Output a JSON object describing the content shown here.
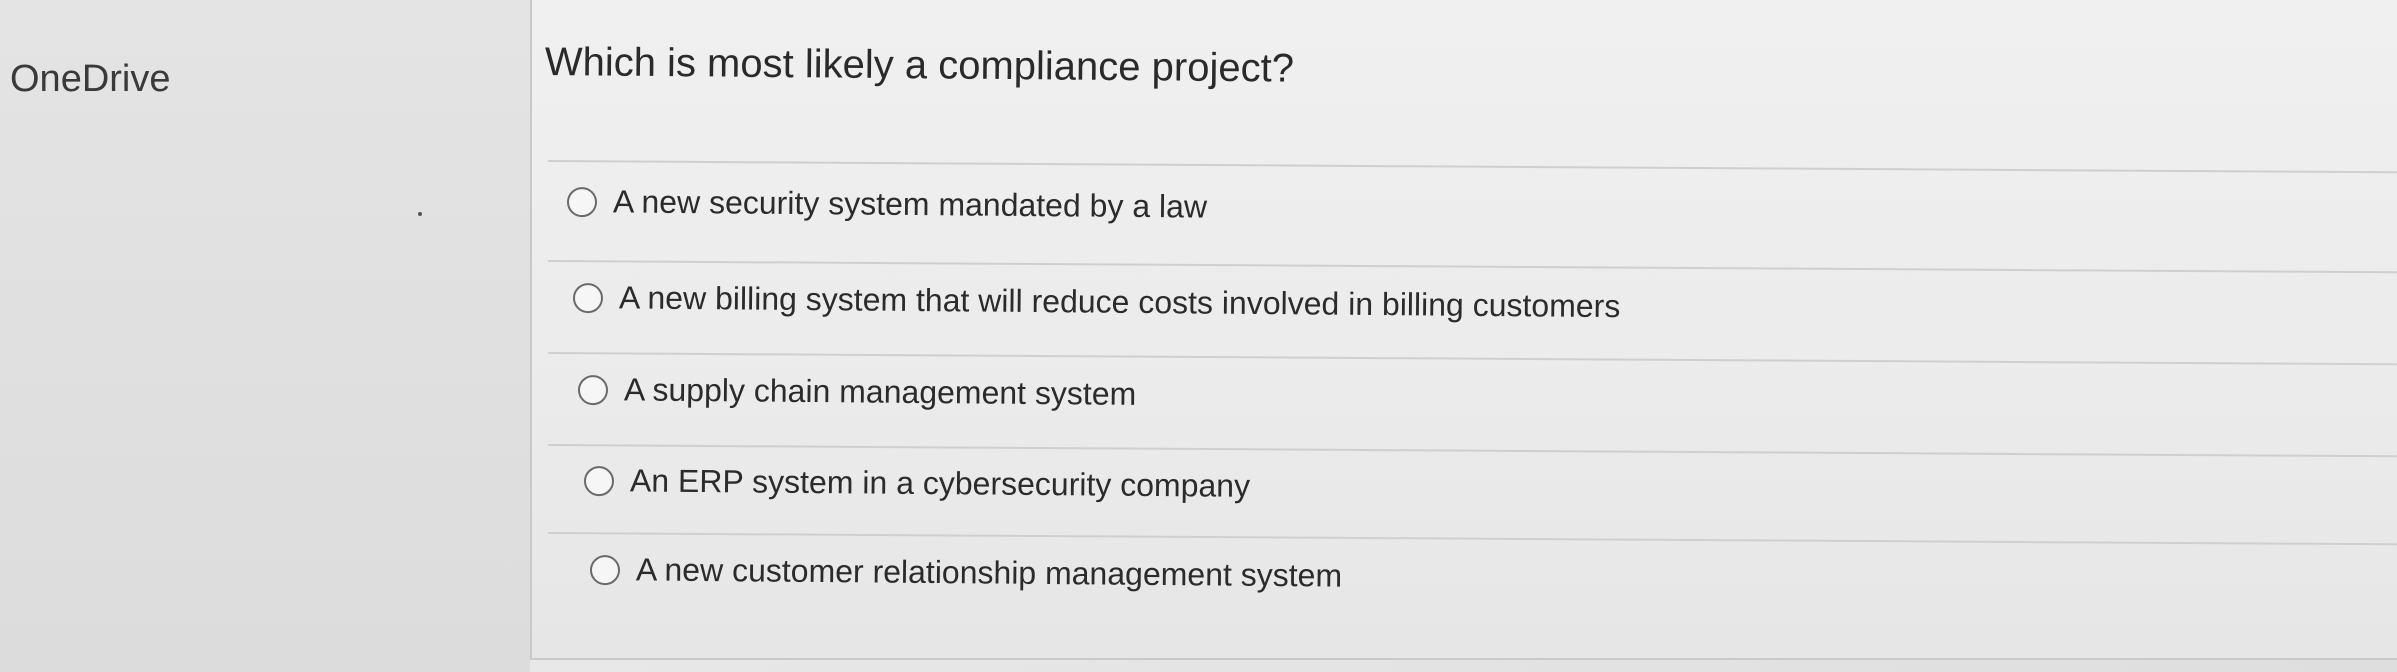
{
  "sidebar": {
    "title": "OneDrive"
  },
  "question": {
    "text": "Which is most likely a compliance project?"
  },
  "options": [
    {
      "label": "A new security system mandated by a law"
    },
    {
      "label": "A new billing system that will reduce costs involved in billing customers"
    },
    {
      "label": "A supply chain management system"
    },
    {
      "label": "An ERP system in a cybersecurity company"
    },
    {
      "label": "A new customer relationship management system"
    }
  ]
}
